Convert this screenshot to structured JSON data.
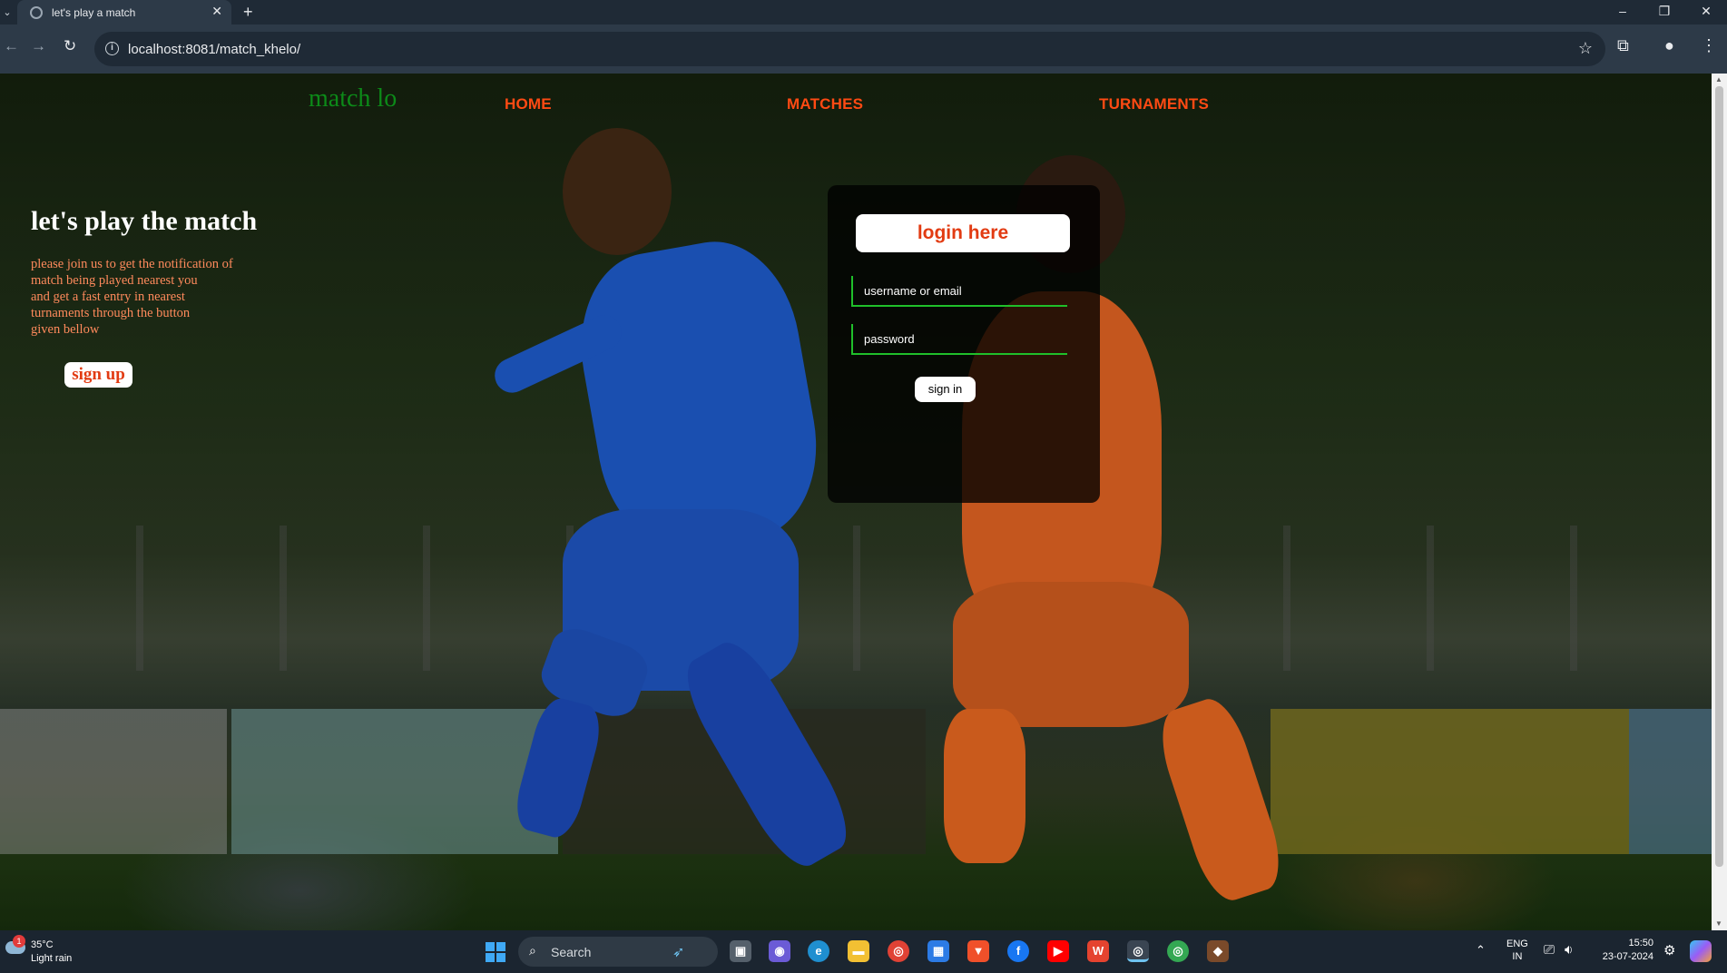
{
  "browser": {
    "tab_title": "let's play a match",
    "url": "localhost:8081/match_khelo/",
    "new_tab_symbol": "+",
    "close_symbol": "✕"
  },
  "site": {
    "brand": "match lo",
    "nav": [
      "HOME",
      "MATCHES",
      "TURNAMENTS"
    ],
    "hero": {
      "title": "let's play the match",
      "lines": [
        "please join us to get the notification of",
        "match being played nearest you",
        "and get a fast entry in nearest",
        "turnaments through the button",
        "given bellow"
      ],
      "signup_label": "sign up"
    },
    "login": {
      "heading": "login here",
      "username_placeholder": "username or email",
      "password_placeholder": "password",
      "signin_label": "sign in"
    }
  },
  "taskbar": {
    "weather_badge": "1",
    "temperature": "35°C",
    "weather": "Light rain",
    "search_label": "Search",
    "lang_line1": "ENG",
    "lang_line2": "IN",
    "time": "15:50",
    "date": "23-07-2024"
  },
  "colors": {
    "accent": "#ff4a13",
    "brand_green": "#0c8a18",
    "field_border": "#1fbf2a"
  }
}
